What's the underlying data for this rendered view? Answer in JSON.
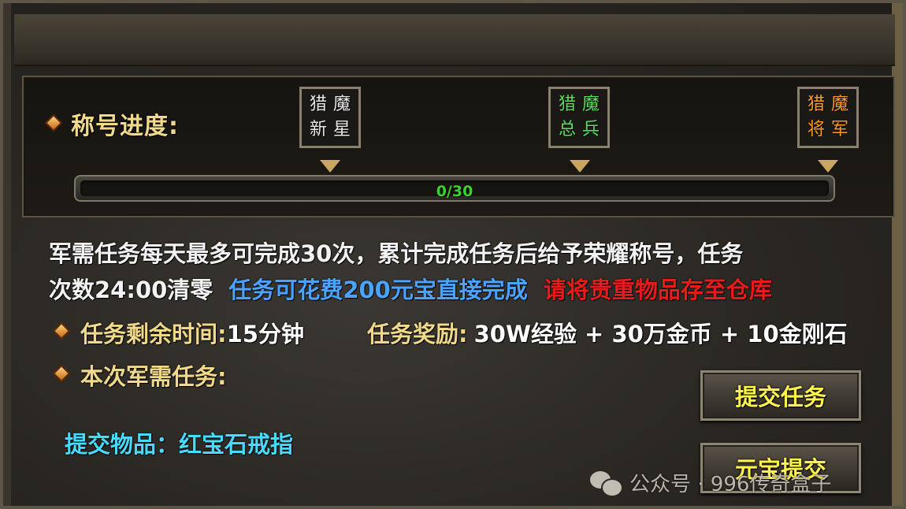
{
  "title_progress": {
    "label": "称号进度:",
    "milestones": [
      {
        "line1": "猎魔",
        "line2": "新星",
        "color": "#e8e8e8"
      },
      {
        "line1": "猎魔",
        "line2": "总兵",
        "color": "#56e05a"
      },
      {
        "line1": "猎魔",
        "line2": "将军",
        "color": "#ff9a1e"
      }
    ],
    "progress_text": "0/30",
    "progress_value": 0,
    "progress_max": 30
  },
  "description": {
    "line1": "军需任务每天最多可完成30次，累计完成任务后给予荣耀称号，任务",
    "line2_white": "次数24:00清零",
    "line2_blue": "任务可花费200元宝直接完成",
    "line2_red": "请将贵重物品存至仓库"
  },
  "task_time": {
    "label": "任务剩余时间:",
    "value": "15分钟"
  },
  "task_reward": {
    "label": "任务奖励:",
    "value": "30W经验 + 30万金币 + 10金刚石"
  },
  "current_task": {
    "label": "本次军需任务:"
  },
  "submit_item": "提交物品：红宝石戒指",
  "buttons": {
    "submit": "提交任务",
    "yuanbao_submit": "元宝提交"
  },
  "watermark": "公众号 · 996传奇盒子",
  "colors": {
    "gold": "#f1d98a",
    "blue": "#4aa3ff",
    "red": "#e81a1a",
    "cyan": "#46dcff",
    "button_text": "#fff34d",
    "progress_text": "#3cd22c"
  }
}
